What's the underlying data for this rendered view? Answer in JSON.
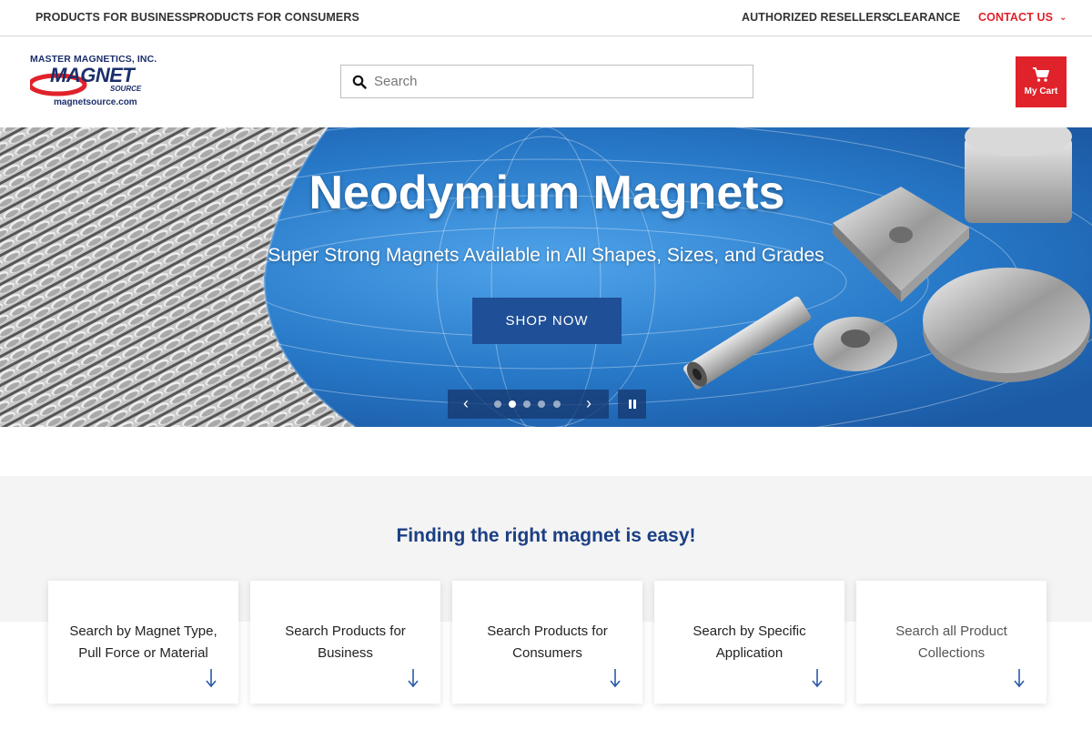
{
  "topnav": {
    "products_business": "PRODUCTS FOR BUSINESS",
    "products_consumers": "PRODUCTS FOR CONSUMERS",
    "authorized_resellers": "AUTHORIZED RESELLERS",
    "clearance": "CLEARANCE",
    "contact_us": "CONTACT US"
  },
  "logo": {
    "company": "MASTER MAGNETICS, INC.",
    "brand": "MAGNET",
    "brand_sub": "SOURCE",
    "url": "magnetsource.com"
  },
  "search": {
    "placeholder": "Search",
    "icon": "search-icon"
  },
  "cart": {
    "label": "My Cart",
    "icon": "cart-icon"
  },
  "hero": {
    "title": "Neodymium Magnets",
    "subtitle": "Super Strong Magnets Available in All Shapes, Sizes, and Grades",
    "button": "SHOP NOW",
    "slides_total": 5,
    "active_slide": 2
  },
  "finder": {
    "title": "Finding the right magnet is easy!",
    "cards": [
      {
        "label_line1": "Search by Magnet Type,",
        "label_line2": "Pull Force or Material"
      },
      {
        "label_line1": "Search Products for",
        "label_line2": "Business"
      },
      {
        "label_line1": "Search Products for",
        "label_line2": "Consumers"
      },
      {
        "label_line1": "Search by Specific",
        "label_line2": "Application"
      },
      {
        "label_line1": "Search all Product",
        "label_line2": "Collections"
      }
    ]
  },
  "colors": {
    "accent_red": "#e0222a",
    "brand_navy": "#1b2f6b",
    "hero_blue": "#2f7dc9",
    "button_blue": "#1f4f96",
    "heading_blue": "#1b3f84"
  }
}
